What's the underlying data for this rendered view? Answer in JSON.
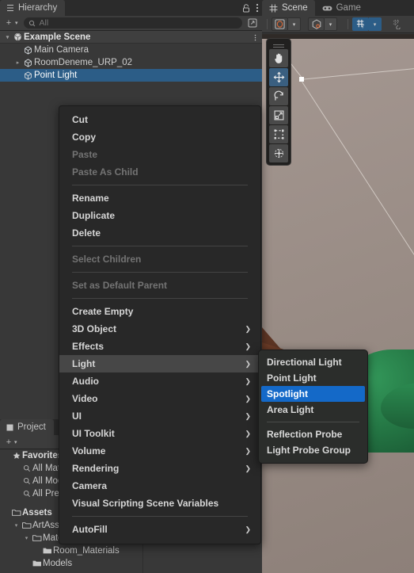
{
  "hierarchy": {
    "tab_label": "Hierarchy",
    "tab_icon": "hierarchy-icon",
    "lock_icon": "lock-icon",
    "kebab_icon": "kebab-menu-icon",
    "toolbar": {
      "add_label": "+",
      "caret_label": "▾",
      "search_placeholder": "All",
      "search_value": "",
      "search_icon": "search-dropdown-icon",
      "popout_icon": "popout-icon"
    },
    "rows": [
      {
        "label": "Example Scene",
        "twisty": "▾",
        "icon": "unity-scene-icon",
        "indent": 0,
        "selected": false,
        "is_scene": true,
        "kebab": true
      },
      {
        "label": "Main Camera",
        "twisty": "",
        "icon": "gameobject-cube-icon",
        "indent": 1,
        "selected": false,
        "is_scene": false,
        "kebab": false
      },
      {
        "label": "RoomDeneme_URP_02",
        "twisty": "▸",
        "icon": "gameobject-cube-icon",
        "indent": 1,
        "selected": false,
        "is_scene": false,
        "kebab": false
      },
      {
        "label": "Point Light",
        "twisty": "",
        "icon": "gameobject-cube-icon",
        "indent": 1,
        "selected": true,
        "is_scene": false,
        "kebab": false
      }
    ]
  },
  "project": {
    "tab_label": "Project",
    "tab_icon": "project-icon",
    "toolbar": {
      "add_label": "+",
      "caret_label": "▾"
    },
    "rows": [
      {
        "label": "Favorites",
        "twisty": "",
        "icon": "star-icon",
        "indent": 0,
        "bold": true
      },
      {
        "label": "All Materials",
        "twisty": "",
        "icon": "search-icon",
        "indent": 1,
        "bold": false
      },
      {
        "label": "All Models",
        "twisty": "",
        "icon": "search-icon",
        "indent": 1,
        "bold": false
      },
      {
        "label": "All Prefabs",
        "twisty": "",
        "icon": "search-icon",
        "indent": 1,
        "bold": false
      },
      {
        "spacer": true
      },
      {
        "label": "Assets",
        "twisty": "",
        "icon": "folder-open-icon",
        "indent": 0,
        "bold": true
      },
      {
        "label": "ArtAssets",
        "twisty": "▾",
        "icon": "folder-open-icon",
        "indent": 1,
        "bold": false
      },
      {
        "label": "Materials",
        "twisty": "▾",
        "icon": "folder-open-icon",
        "indent": 2,
        "bold": false
      },
      {
        "label": "Room_Materials",
        "twisty": "",
        "icon": "folder-icon",
        "indent": 3,
        "bold": false
      },
      {
        "label": "Models",
        "twisty": "",
        "icon": "folder-icon",
        "indent": 2,
        "bold": false
      }
    ]
  },
  "scene": {
    "tabs": [
      {
        "label": "Scene",
        "icon": "grid-scene-icon",
        "active": true
      },
      {
        "label": "Game",
        "icon": "gamepad-icon",
        "active": false
      }
    ],
    "toolbar": [
      {
        "name": "draw-mode-button",
        "icon": "shaded-mode-icon",
        "style": "dk",
        "dropdown": true
      },
      {
        "name": "2d-toggle-button",
        "icon": "cube-2d-icon",
        "style": "dk",
        "dropdown": true
      },
      {
        "name": "grid-visibility-button",
        "icon": "grid-y-axis-icon",
        "style": "acc",
        "dropdown": true
      },
      {
        "name": "snap-increment-button",
        "icon": "grid-snap-icon",
        "style": "flat",
        "dropdown": false
      }
    ],
    "tool_palette": [
      {
        "name": "hand-tool",
        "icon": "hand-icon",
        "active": false
      },
      {
        "name": "move-tool",
        "icon": "move-arrows-icon",
        "active": true
      },
      {
        "name": "rotate-tool",
        "icon": "rotate-icon",
        "active": false
      },
      {
        "name": "scale-tool",
        "icon": "scale-icon",
        "active": false
      },
      {
        "name": "rect-tool",
        "icon": "rect-transform-icon",
        "active": false
      },
      {
        "name": "transform-tool",
        "icon": "combined-transform-icon",
        "active": false
      }
    ],
    "colors": {
      "wall": "#9a8d86",
      "floor": "#6d3d28",
      "corner": "#5d3524",
      "object_green": "#22713f",
      "gizmo_line": "#d9d2cd",
      "handle": "#ffffff"
    }
  },
  "context_menu": {
    "items": [
      {
        "label": "Cut",
        "disabled": false,
        "submenu": false,
        "highlight": false
      },
      {
        "label": "Copy",
        "disabled": false,
        "submenu": false,
        "highlight": false
      },
      {
        "label": "Paste",
        "disabled": true,
        "submenu": false,
        "highlight": false
      },
      {
        "label": "Paste As Child",
        "disabled": true,
        "submenu": false,
        "highlight": false
      },
      {
        "separator": true
      },
      {
        "label": "Rename",
        "disabled": false,
        "submenu": false,
        "highlight": false
      },
      {
        "label": "Duplicate",
        "disabled": false,
        "submenu": false,
        "highlight": false
      },
      {
        "label": "Delete",
        "disabled": false,
        "submenu": false,
        "highlight": false
      },
      {
        "separator": true
      },
      {
        "label": "Select Children",
        "disabled": true,
        "submenu": false,
        "highlight": false
      },
      {
        "separator": true
      },
      {
        "label": "Set as Default Parent",
        "disabled": true,
        "submenu": false,
        "highlight": false
      },
      {
        "separator": true
      },
      {
        "label": "Create Empty",
        "disabled": false,
        "submenu": false,
        "highlight": false
      },
      {
        "label": "3D Object",
        "disabled": false,
        "submenu": true,
        "highlight": false
      },
      {
        "label": "Effects",
        "disabled": false,
        "submenu": true,
        "highlight": false
      },
      {
        "label": "Light",
        "disabled": false,
        "submenu": true,
        "highlight": true
      },
      {
        "label": "Audio",
        "disabled": false,
        "submenu": true,
        "highlight": false
      },
      {
        "label": "Video",
        "disabled": false,
        "submenu": true,
        "highlight": false
      },
      {
        "label": "UI",
        "disabled": false,
        "submenu": true,
        "highlight": false
      },
      {
        "label": "UI Toolkit",
        "disabled": false,
        "submenu": true,
        "highlight": false
      },
      {
        "label": "Volume",
        "disabled": false,
        "submenu": true,
        "highlight": false
      },
      {
        "label": "Rendering",
        "disabled": false,
        "submenu": true,
        "highlight": false
      },
      {
        "label": "Camera",
        "disabled": false,
        "submenu": false,
        "highlight": false
      },
      {
        "label": "Visual Scripting Scene Variables",
        "disabled": false,
        "submenu": false,
        "highlight": false
      },
      {
        "separator": true
      },
      {
        "label": "AutoFill",
        "disabled": false,
        "submenu": true,
        "highlight": false
      }
    ],
    "arrow_glyph": "❯"
  },
  "submenu": {
    "items": [
      {
        "label": "Directional Light",
        "selected": false
      },
      {
        "label": "Point Light",
        "selected": false
      },
      {
        "label": "Spotlight",
        "selected": true
      },
      {
        "label": "Area Light",
        "selected": false
      },
      {
        "separator": true
      },
      {
        "label": "Reflection Probe",
        "selected": false
      },
      {
        "label": "Light Probe Group",
        "selected": false
      }
    ],
    "highlight_color": "#1469c8"
  }
}
